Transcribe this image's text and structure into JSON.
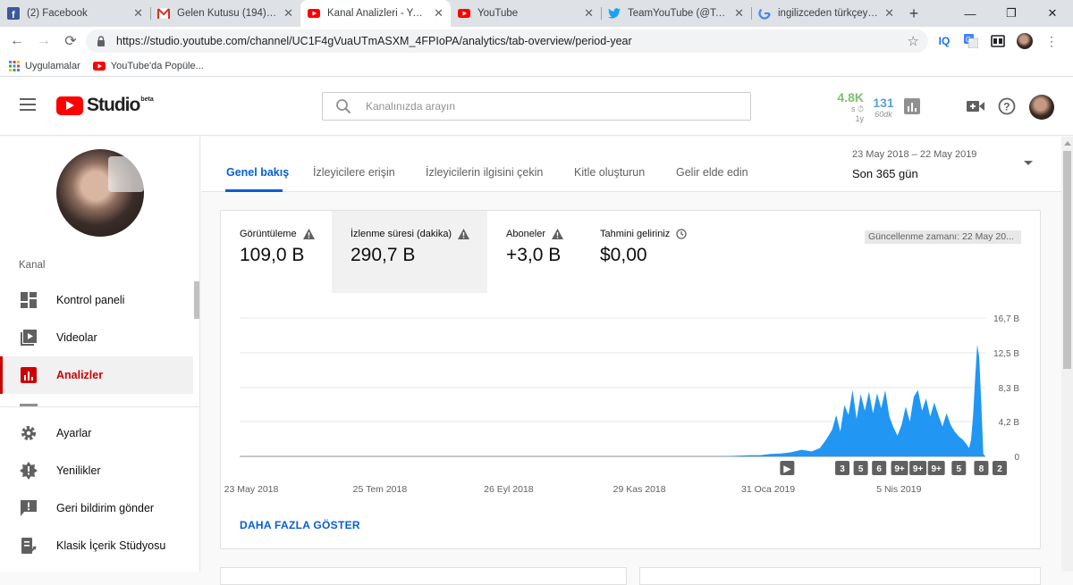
{
  "browser": {
    "tabs": [
      {
        "title": "(2) Facebook",
        "icon": "facebook-icon",
        "active": false
      },
      {
        "title": "Gelen Kutusu (194) - se",
        "icon": "gmail-icon",
        "active": false
      },
      {
        "title": "Kanal Analizleri - YouTu",
        "icon": "youtube-icon",
        "active": true
      },
      {
        "title": "YouTube",
        "icon": "youtube-icon",
        "active": false
      },
      {
        "title": "TeamYouTube (@TeamY",
        "icon": "twitter-icon",
        "active": false
      },
      {
        "title": "ingilizceden türkçeye ç",
        "icon": "google-icon",
        "active": false
      }
    ],
    "url": "https://studio.youtube.com/channel/UC1F4gVuaUTmASXM_4FPIoPA/analytics/tab-overview/period-year",
    "bookmarks": [
      {
        "label": "Uygulamalar",
        "icon": "apps-grid-icon"
      },
      {
        "label": "YouTube'da Popüle...",
        "icon": "youtube-icon"
      }
    ],
    "extension_iq": "IQ"
  },
  "header": {
    "logo_text": "Studio",
    "logo_badge": "beta",
    "search_placeholder": "Kanalınızda arayın",
    "realtime": {
      "value": "4.8K",
      "unit": "s",
      "period": "1y"
    },
    "minutes": {
      "value": "131",
      "period": "60dk"
    }
  },
  "sidebar": {
    "section": "Kanal",
    "items": [
      {
        "label": "Kontrol paneli",
        "icon": "dashboard-icon",
        "active": false
      },
      {
        "label": "Videolar",
        "icon": "videos-icon",
        "active": false
      },
      {
        "label": "Analizler",
        "icon": "analytics-icon",
        "active": true
      },
      {
        "label": "Ayarlar",
        "icon": "settings-icon",
        "active": false
      },
      {
        "label": "Yenilikler",
        "icon": "whats-new-icon",
        "active": false
      },
      {
        "label": "Geri bildirim gönder",
        "icon": "feedback-icon",
        "active": false
      },
      {
        "label": "Klasik İçerik Stüdyosu",
        "icon": "classic-studio-icon",
        "active": false
      }
    ]
  },
  "analytics": {
    "tabs": [
      "Genel bakış",
      "İzleyicilere erişin",
      "İzleyicilerin ilgisini çekin",
      "Kitle oluşturun",
      "Gelir elde edin"
    ],
    "active_tab": 0,
    "period_range": "23 May 2018 – 22 May 2019",
    "period_label": "Son 365 gün",
    "metrics": [
      {
        "name": "Görüntüleme",
        "value": "109,0 B",
        "icon": "warning-icon",
        "selected": false
      },
      {
        "name": "İzlenme süresi (dakika)",
        "value": "290,7 B",
        "icon": "warning-icon",
        "selected": true
      },
      {
        "name": "Aboneler",
        "value": "+3,0 B",
        "icon": "warning-icon",
        "selected": false
      },
      {
        "name": "Tahmini geliriniz",
        "value": "$0,00",
        "icon": "clock-icon",
        "selected": false
      }
    ],
    "updated": "Güncellenme zamanı: 22 May 20...",
    "show_more": "DAHA FAZLA GÖSTER"
  },
  "chart_data": {
    "type": "area",
    "metric": "İzlenme süresi (dakika)",
    "color": "#2196f3",
    "x_start": "23 May 2018",
    "x_end": "22 May 2019",
    "total_days": 365,
    "x_ticks": [
      {
        "label": "23 May 2018",
        "day": 0
      },
      {
        "label": "25 Tem 2018",
        "day": 63
      },
      {
        "label": "26 Eyl 2018",
        "day": 126
      },
      {
        "label": "29 Kas 2018",
        "day": 190
      },
      {
        "label": "31 Oca 2019",
        "day": 253
      },
      {
        "label": "5 Nis 2019",
        "day": 317
      }
    ],
    "y_ticks": [
      "0",
      "4,2 B",
      "8,3 B",
      "12,5 B",
      "16,7 B"
    ],
    "y_tick_values": [
      0,
      4.2,
      8.3,
      12.5,
      16.7
    ],
    "ylim": [
      0,
      16.7
    ],
    "points": [
      [
        0,
        0
      ],
      [
        235,
        0
      ],
      [
        240,
        0.05
      ],
      [
        245,
        0.1
      ],
      [
        250,
        0.15
      ],
      [
        255,
        0.15
      ],
      [
        260,
        0.3
      ],
      [
        265,
        0.35
      ],
      [
        270,
        0.5
      ],
      [
        275,
        0.8
      ],
      [
        280,
        0.6
      ],
      [
        284,
        1.0
      ],
      [
        287,
        2.0
      ],
      [
        290,
        3.2
      ],
      [
        292,
        5.0
      ],
      [
        294,
        3.0
      ],
      [
        296,
        6.2
      ],
      [
        298,
        5.0
      ],
      [
        300,
        8.0
      ],
      [
        302,
        4.5
      ],
      [
        304,
        7.5
      ],
      [
        306,
        5.5
      ],
      [
        308,
        7.8
      ],
      [
        310,
        5.2
      ],
      [
        312,
        7.6
      ],
      [
        314,
        5.8
      ],
      [
        316,
        8.0
      ],
      [
        318,
        4.8
      ],
      [
        320,
        3.5
      ],
      [
        322,
        2.5
      ],
      [
        324,
        3.8
      ],
      [
        326,
        6.0
      ],
      [
        328,
        4.2
      ],
      [
        330,
        7.2
      ],
      [
        332,
        8.0
      ],
      [
        334,
        5.5
      ],
      [
        336,
        7.0
      ],
      [
        338,
        4.8
      ],
      [
        340,
        6.5
      ],
      [
        342,
        5.0
      ],
      [
        344,
        3.6
      ],
      [
        346,
        5.2
      ],
      [
        348,
        3.8
      ],
      [
        350,
        3.0
      ],
      [
        352,
        2.4
      ],
      [
        354,
        2.0
      ],
      [
        356,
        1.4
      ],
      [
        357,
        1.0
      ],
      [
        358,
        2.0
      ],
      [
        359,
        5.0
      ],
      [
        360,
        9.5
      ],
      [
        361,
        13.5
      ],
      [
        362,
        12.0
      ],
      [
        363,
        6.5
      ],
      [
        364,
        0.3
      ],
      [
        365,
        0
      ]
    ],
    "annotations": [
      {
        "label": "▶",
        "day": 268
      },
      {
        "label": "3",
        "day": 295
      },
      {
        "label": "5",
        "day": 304
      },
      {
        "label": "6",
        "day": 313
      },
      {
        "label": "9+",
        "day": 323
      },
      {
        "label": "9+",
        "day": 332
      },
      {
        "label": "9+",
        "day": 341
      },
      {
        "label": "5",
        "day": 352
      },
      {
        "label": "8",
        "day": 363
      },
      {
        "label": "2",
        "day": 372
      }
    ]
  }
}
